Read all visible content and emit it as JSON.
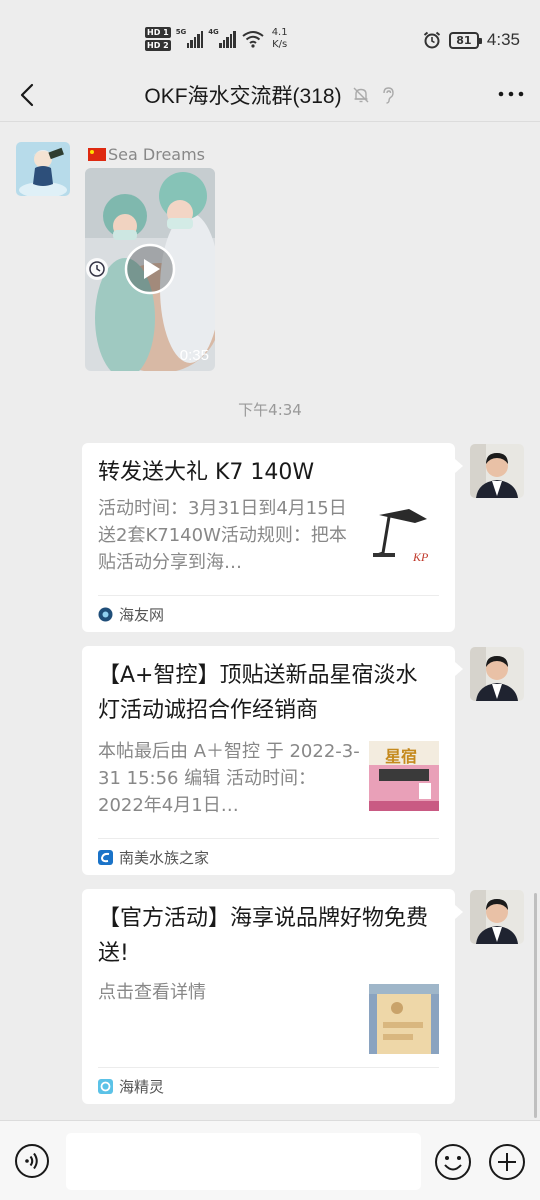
{
  "status_bar": {
    "hd1": "HD 1",
    "hd2": "HD 2",
    "sig1": "5G",
    "sig2": "4G",
    "net_speed_value": "4.1",
    "net_speed_unit": "K/s",
    "battery": "81",
    "time": "4:35"
  },
  "header": {
    "title": "OKF海水交流群(318)"
  },
  "chat": {
    "video_message": {
      "sender": "Sea Dreams",
      "duration": "0:35"
    },
    "time_separator": "下午4:34",
    "cards": [
      {
        "title": "转发送大礼 K7 140W",
        "description": "活动时间：3月31日到4月15日送2套K7140W活动规则：把本贴活动分享到海…",
        "source": "海友网"
      },
      {
        "title": "【A+智控】顶贴送新品星宿淡水灯活动诚招合作经销商",
        "description": " 本帖最后由 A＋智控 于 2022-3-31 15:56 编辑 活动时间：2022年4月1日…",
        "thumb_text": "星宿",
        "source": "南美水族之家"
      },
      {
        "title": "【官方活动】海享说品牌好物免费送!",
        "description": "点击查看详情",
        "source": "海精灵"
      }
    ]
  },
  "colors": {
    "background": "#ededed",
    "card": "#ffffff",
    "muted_text": "#888888"
  }
}
